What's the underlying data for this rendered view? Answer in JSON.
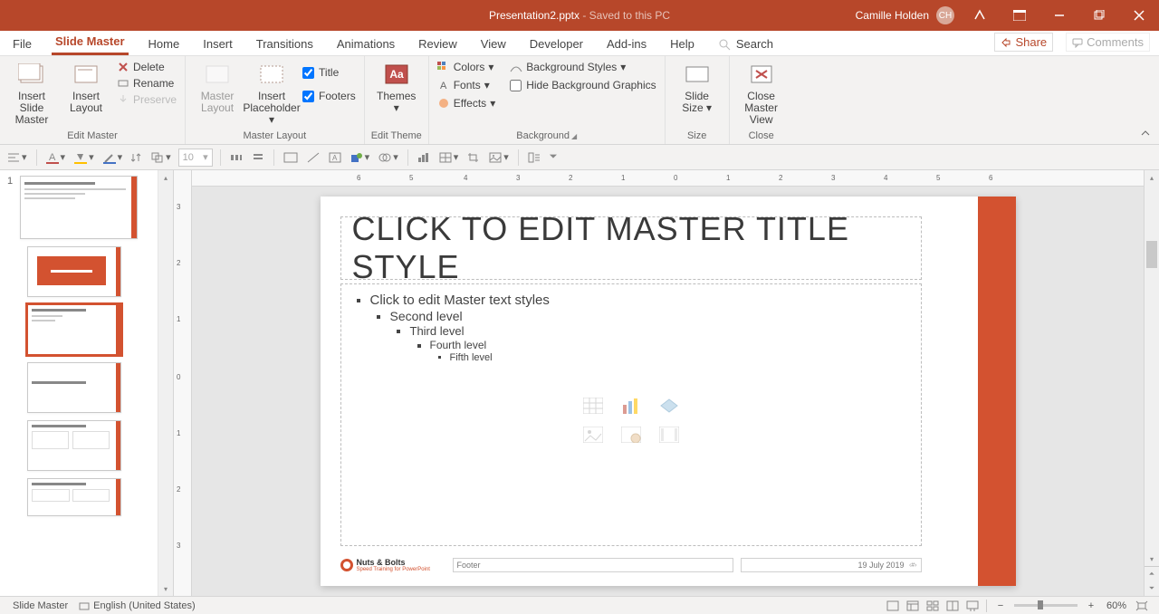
{
  "titlebar": {
    "filename": "Presentation2.pptx",
    "savestate": " - Saved to this PC",
    "user": "Camille Holden",
    "initials": "CH"
  },
  "tabs": {
    "file": "File",
    "slidemaster": "Slide Master",
    "home": "Home",
    "insert": "Insert",
    "transitions": "Transitions",
    "animations": "Animations",
    "review": "Review",
    "view": "View",
    "developer": "Developer",
    "addins": "Add-ins",
    "help": "Help",
    "tellme": "Search"
  },
  "buttons": {
    "share": "Share",
    "comments": "Comments"
  },
  "ribbon": {
    "edit_master": {
      "label": "Edit Master",
      "insert_slide_master": "Insert Slide\nMaster",
      "insert_layout": "Insert\nLayout",
      "delete": "Delete",
      "rename": "Rename",
      "preserve": "Preserve"
    },
    "master_layout": {
      "label": "Master Layout",
      "master_layout": "Master\nLayout",
      "insert_placeholder": "Insert\nPlaceholder",
      "title": "Title",
      "footers": "Footers"
    },
    "edit_theme": {
      "label": "Edit Theme",
      "themes": "Themes"
    },
    "background": {
      "label": "Background",
      "colors": "Colors",
      "fonts": "Fonts",
      "effects": "Effects",
      "bgstyles": "Background Styles",
      "hidebg": "Hide Background Graphics"
    },
    "size": {
      "label": "Size",
      "slide_size": "Slide\nSize"
    },
    "close": {
      "label": "Close",
      "close_master": "Close\nMaster View"
    }
  },
  "toolstrip": {
    "fontsize": "10"
  },
  "slide": {
    "title_placeholder": "CLICK TO EDIT MASTER TITLE STYLE",
    "body_l1": "Click to edit Master text styles",
    "body_l2": "Second level",
    "body_l3": "Third level",
    "body_l4": "Fourth level",
    "body_l5": "Fifth level",
    "footer_label": "Footer",
    "date": "19 July 2019",
    "slidenum": "‹#›",
    "logo_line1": "Nuts & Bolts",
    "logo_line2": "Speed Training for PowerPoint"
  },
  "statusbar": {
    "view": "Slide Master",
    "lang": "English (United States)",
    "zoom": "60%"
  },
  "thumb_num": "1",
  "ruler_h": [
    "6",
    "5",
    "4",
    "3",
    "2",
    "1",
    "0",
    "1",
    "2",
    "3",
    "4",
    "5",
    "6"
  ],
  "ruler_v": [
    "3",
    "2",
    "1",
    "0",
    "1",
    "2",
    "3"
  ]
}
